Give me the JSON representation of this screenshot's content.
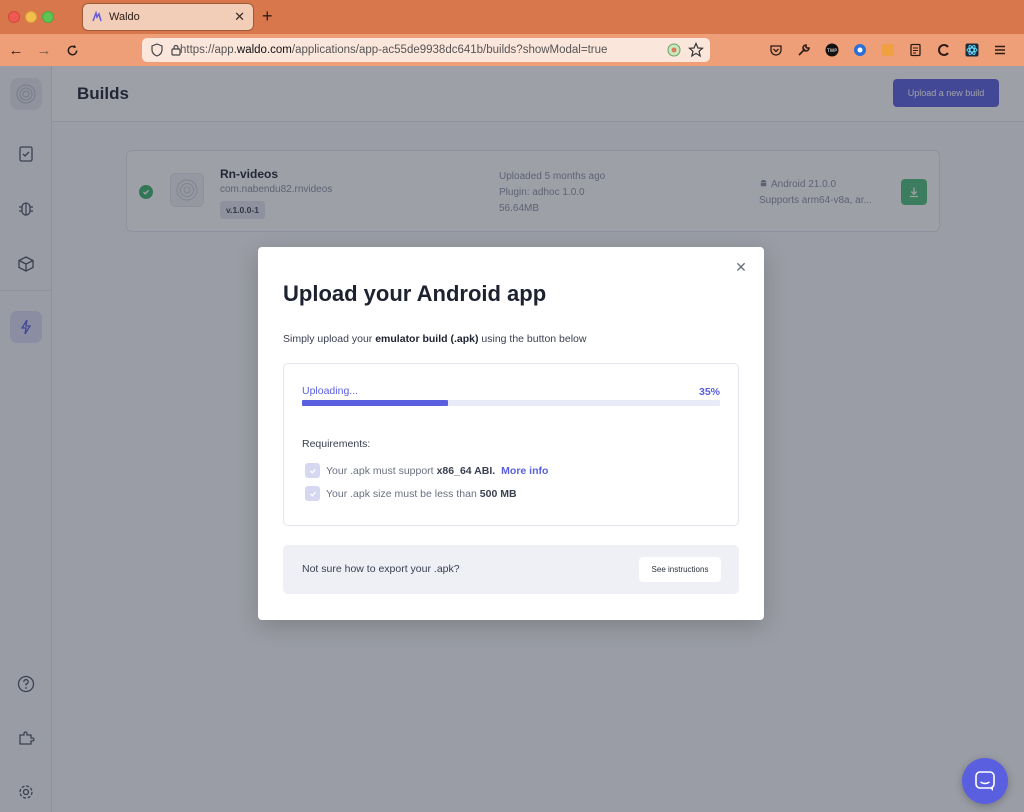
{
  "browser": {
    "tab_title": "Waldo",
    "url_host": "https://app.",
    "url_domain": "waldo.com",
    "url_path": "/applications/app-ac55de9938dc641b/builds?showModal=true"
  },
  "header": {
    "title": "Builds",
    "upload_button": "Upload a new build"
  },
  "build": {
    "name": "Rn-videos",
    "package": "com.nabendu82.rnvideos",
    "version": "v.1.0.0-1",
    "uploaded": "Uploaded 5 months ago",
    "plugin": "Plugin: adhoc 1.0.0",
    "size": "56.64MB",
    "android": "Android 21.0.0",
    "supports": "Supports arm64-v8a, ar..."
  },
  "modal": {
    "title": "Upload your Android app",
    "subtitle_pre": "Simply upload your ",
    "subtitle_bold": "emulator build (.apk)",
    "subtitle_post": " using the button below",
    "uploading_label": "Uploading...",
    "progress_text": "35%",
    "progress": 0.35,
    "requirements_title": "Requirements:",
    "req1_pre": "Your .apk must support",
    "req1_bold": "x86_64 ABI.",
    "req1_link": "More info",
    "req2_pre": "Your .apk size must be less than",
    "req2_bold": "500 MB",
    "help_text": "Not sure how to export your .apk?",
    "help_button": "See instructions"
  },
  "colors": {
    "accent": "#5a5fe0",
    "titlebar": "#d9774c",
    "navbar": "#ef9f77",
    "success": "#3bb56b"
  }
}
